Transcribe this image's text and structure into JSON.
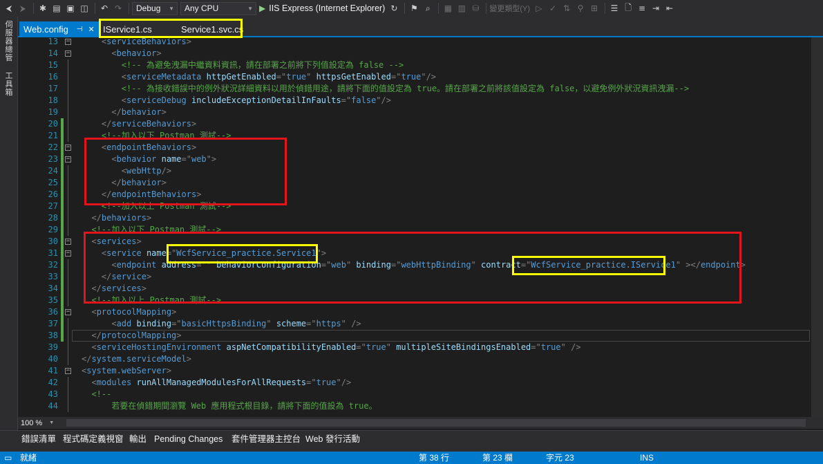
{
  "toolbar": {
    "config": "Debug",
    "platform": "Any CPU",
    "run_label": "IIS Express (Internet Explorer)",
    "change_type_label": "變更類型(Y)"
  },
  "side_tabs": [
    "伺服器總管",
    "工具箱"
  ],
  "tabs": {
    "active": "Web.config",
    "others": [
      "IService1.cs",
      "Service1.svc.cs"
    ]
  },
  "editor": {
    "line_numbers": [
      "13",
      "14",
      "15",
      "16",
      "17",
      "18",
      "19",
      "20",
      "21",
      "22",
      "23",
      "24",
      "25",
      "26",
      "27",
      "28",
      "29",
      "30",
      "31",
      "32",
      "33",
      "34",
      "35",
      "36",
      "37",
      "38",
      "39",
      "40",
      "41",
      "42",
      "43",
      "44"
    ],
    "lines": [
      [
        {
          "k": "t",
          "s": "    <"
        },
        {
          "k": "e",
          "s": "serviceBehaviors"
        },
        {
          "k": "t",
          "s": ">"
        }
      ],
      [
        {
          "k": "t",
          "s": "      <"
        },
        {
          "k": "e",
          "s": "behavior"
        },
        {
          "k": "t",
          "s": ">"
        }
      ],
      [
        {
          "k": "c",
          "s": "        <!-- 為避免洩漏中繼資料資訊，請在部署之前將下列值設定為 false -->"
        }
      ],
      [
        {
          "k": "t",
          "s": "        <"
        },
        {
          "k": "e",
          "s": "serviceMetadata"
        },
        {
          "k": "t",
          "s": " "
        },
        {
          "k": "a",
          "s": "httpGetEnabled"
        },
        {
          "k": "t",
          "s": "=\""
        },
        {
          "k": "e",
          "s": "true"
        },
        {
          "k": "t",
          "s": "\" "
        },
        {
          "k": "a",
          "s": "httpsGetEnabled"
        },
        {
          "k": "t",
          "s": "=\""
        },
        {
          "k": "e",
          "s": "true"
        },
        {
          "k": "t",
          "s": "\"/>"
        }
      ],
      [
        {
          "k": "c",
          "s": "        <!-- 為接收錯誤中的例外狀況詳細資料以用於偵錯用途，請將下面的值設定為 true。請在部署之前將該值設定為 false，以避免例外狀況資訊洩漏-->"
        }
      ],
      [
        {
          "k": "t",
          "s": "        <"
        },
        {
          "k": "e",
          "s": "serviceDebug"
        },
        {
          "k": "t",
          "s": " "
        },
        {
          "k": "a",
          "s": "includeExceptionDetailInFaults"
        },
        {
          "k": "t",
          "s": "=\""
        },
        {
          "k": "e",
          "s": "false"
        },
        {
          "k": "t",
          "s": "\"/>"
        }
      ],
      [
        {
          "k": "t",
          "s": "      </"
        },
        {
          "k": "e",
          "s": "behavior"
        },
        {
          "k": "t",
          "s": ">"
        }
      ],
      [
        {
          "k": "t",
          "s": "    </"
        },
        {
          "k": "e",
          "s": "serviceBehaviors"
        },
        {
          "k": "t",
          "s": ">"
        }
      ],
      [
        {
          "k": "c",
          "s": "    <!--加入以下 Postman 測試-->"
        }
      ],
      [
        {
          "k": "t",
          "s": "    <"
        },
        {
          "k": "e",
          "s": "endpointBehaviors"
        },
        {
          "k": "t",
          "s": ">"
        }
      ],
      [
        {
          "k": "t",
          "s": "      <"
        },
        {
          "k": "e",
          "s": "behavior"
        },
        {
          "k": "t",
          "s": " "
        },
        {
          "k": "a",
          "s": "name"
        },
        {
          "k": "t",
          "s": "=\""
        },
        {
          "k": "e",
          "s": "web"
        },
        {
          "k": "t",
          "s": "\">"
        }
      ],
      [
        {
          "k": "t",
          "s": "        <"
        },
        {
          "k": "e",
          "s": "webHttp"
        },
        {
          "k": "t",
          "s": "/>"
        }
      ],
      [
        {
          "k": "t",
          "s": "      </"
        },
        {
          "k": "e",
          "s": "behavior"
        },
        {
          "k": "t",
          "s": ">"
        }
      ],
      [
        {
          "k": "t",
          "s": "    </"
        },
        {
          "k": "e",
          "s": "endpointBehaviors"
        },
        {
          "k": "t",
          "s": ">"
        }
      ],
      [
        {
          "k": "c",
          "s": "    <!--加入以上 Postman 測試-->"
        }
      ],
      [
        {
          "k": "t",
          "s": "  </"
        },
        {
          "k": "e",
          "s": "behaviors"
        },
        {
          "k": "t",
          "s": ">"
        }
      ],
      [
        {
          "k": "c",
          "s": "  <!--加入以下 Postman 測試-->"
        }
      ],
      [
        {
          "k": "t",
          "s": "  <"
        },
        {
          "k": "e",
          "s": "services"
        },
        {
          "k": "t",
          "s": ">"
        }
      ],
      [
        {
          "k": "t",
          "s": "    <"
        },
        {
          "k": "e",
          "s": "service"
        },
        {
          "k": "t",
          "s": " "
        },
        {
          "k": "a",
          "s": "name"
        },
        {
          "k": "t",
          "s": "=\""
        },
        {
          "k": "e",
          "s": "WcfService_practice.Service1"
        },
        {
          "k": "t",
          "s": "\">"
        }
      ],
      [
        {
          "k": "t",
          "s": "      <"
        },
        {
          "k": "e",
          "s": "endpoint"
        },
        {
          "k": "t",
          "s": " "
        },
        {
          "k": "a",
          "s": "address"
        },
        {
          "k": "t",
          "s": "=\"\" "
        },
        {
          "k": "a",
          "s": "behaviorConfiguration"
        },
        {
          "k": "t",
          "s": "=\""
        },
        {
          "k": "e",
          "s": "web"
        },
        {
          "k": "t",
          "s": "\" "
        },
        {
          "k": "a",
          "s": "binding"
        },
        {
          "k": "t",
          "s": "=\""
        },
        {
          "k": "e",
          "s": "webHttpBinding"
        },
        {
          "k": "t",
          "s": "\" "
        },
        {
          "k": "a",
          "s": "contract"
        },
        {
          "k": "t",
          "s": "=\""
        },
        {
          "k": "e",
          "s": "WcfService_practice.IService1"
        },
        {
          "k": "t",
          "s": "\" ></"
        },
        {
          "k": "e",
          "s": "endpoint"
        },
        {
          "k": "t",
          "s": ">"
        }
      ],
      [
        {
          "k": "t",
          "s": "    </"
        },
        {
          "k": "e",
          "s": "service"
        },
        {
          "k": "t",
          "s": ">"
        }
      ],
      [
        {
          "k": "t",
          "s": "  </"
        },
        {
          "k": "e",
          "s": "services"
        },
        {
          "k": "t",
          "s": ">"
        }
      ],
      [
        {
          "k": "c",
          "s": "  <!--加入以上 Postman 測試-->"
        }
      ],
      [
        {
          "k": "t",
          "s": "  <"
        },
        {
          "k": "e",
          "s": "protocolMapping"
        },
        {
          "k": "t",
          "s": ">"
        }
      ],
      [
        {
          "k": "t",
          "s": "      <"
        },
        {
          "k": "e",
          "s": "add"
        },
        {
          "k": "t",
          "s": " "
        },
        {
          "k": "a",
          "s": "binding"
        },
        {
          "k": "t",
          "s": "=\""
        },
        {
          "k": "e",
          "s": "basicHttpsBinding"
        },
        {
          "k": "t",
          "s": "\" "
        },
        {
          "k": "a",
          "s": "scheme"
        },
        {
          "k": "t",
          "s": "=\""
        },
        {
          "k": "e",
          "s": "https"
        },
        {
          "k": "t",
          "s": "\" />"
        }
      ],
      [
        {
          "k": "t",
          "s": "  </"
        },
        {
          "k": "e",
          "s": "protocolMapping"
        },
        {
          "k": "t",
          "s": ">"
        }
      ],
      [
        {
          "k": "t",
          "s": "  <"
        },
        {
          "k": "e",
          "s": "serviceHostingEnvironment"
        },
        {
          "k": "t",
          "s": " "
        },
        {
          "k": "a",
          "s": "aspNetCompatibilityEnabled"
        },
        {
          "k": "t",
          "s": "=\""
        },
        {
          "k": "e",
          "s": "true"
        },
        {
          "k": "t",
          "s": "\" "
        },
        {
          "k": "a",
          "s": "multipleSiteBindingsEnabled"
        },
        {
          "k": "t",
          "s": "=\""
        },
        {
          "k": "e",
          "s": "true"
        },
        {
          "k": "t",
          "s": "\" />"
        }
      ],
      [
        {
          "k": "t",
          "s": "</"
        },
        {
          "k": "e",
          "s": "system.serviceModel"
        },
        {
          "k": "t",
          "s": ">"
        }
      ],
      [
        {
          "k": "t",
          "s": "<"
        },
        {
          "k": "e",
          "s": "system.webServer"
        },
        {
          "k": "t",
          "s": ">"
        }
      ],
      [
        {
          "k": "t",
          "s": "  <"
        },
        {
          "k": "e",
          "s": "modules"
        },
        {
          "k": "t",
          "s": " "
        },
        {
          "k": "a",
          "s": "runAllManagedModulesForAllRequests"
        },
        {
          "k": "t",
          "s": "=\""
        },
        {
          "k": "e",
          "s": "true"
        },
        {
          "k": "t",
          "s": "\"/>"
        }
      ],
      [
        {
          "k": "c",
          "s": "  <!--"
        }
      ],
      [
        {
          "k": "c",
          "s": "      若要在偵錯期間瀏覽 Web 應用程式根目錄，請將下面的值設為 true。"
        }
      ]
    ]
  },
  "zoom": "100 %",
  "bottom_tabs": [
    "錯誤清單",
    "程式碼定義視窗",
    "輸出",
    "Pending Changes",
    "套件管理器主控台",
    "Web 發行活動"
  ],
  "status": {
    "ready": "就緒",
    "line": "第 38 行",
    "col": "第 23 欄",
    "ch": "字元 23",
    "ins": "INS"
  }
}
